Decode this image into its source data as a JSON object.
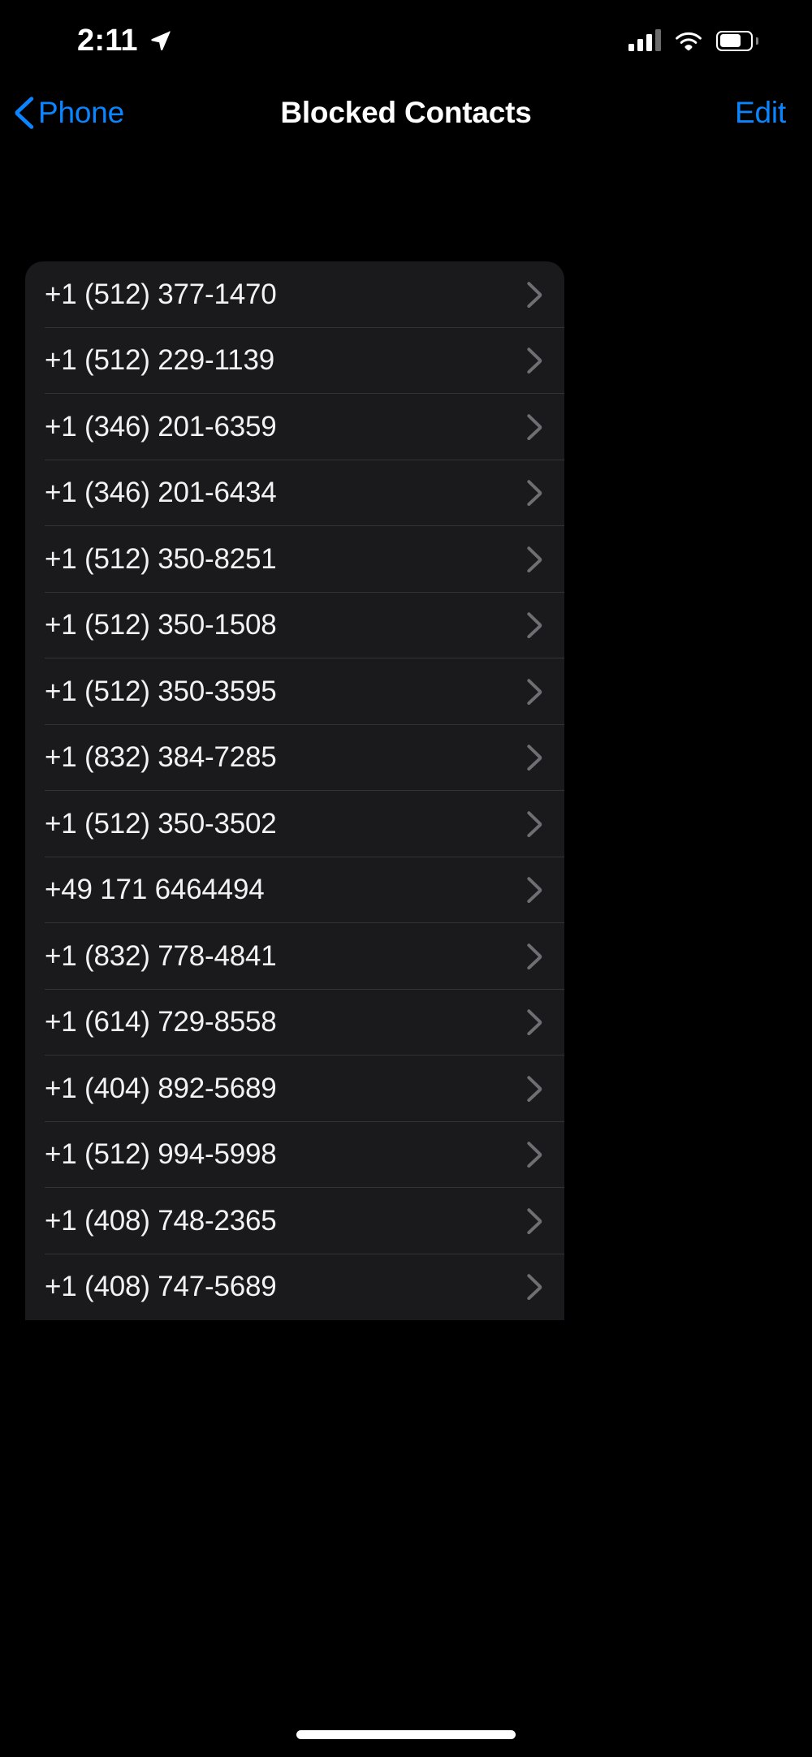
{
  "status_bar": {
    "time": "2:11",
    "location_icon": "location-arrow-icon",
    "cellular_icon": "cellular-signal-icon",
    "cellular_bars_filled": 3,
    "wifi_icon": "wifi-icon",
    "battery_icon": "battery-icon",
    "battery_level_percent": 72
  },
  "nav_bar": {
    "back_icon": "chevron-left-icon",
    "back_label": "Phone",
    "title": "Blocked Contacts",
    "edit_label": "Edit",
    "accent_color": "#0a84ff"
  },
  "list": {
    "disclosure_icon": "chevron-right-icon",
    "items": [
      {
        "number": "+1 (512) 377-1470"
      },
      {
        "number": "+1 (512) 229-1139"
      },
      {
        "number": "+1 (346) 201-6359"
      },
      {
        "number": "+1 (346) 201-6434"
      },
      {
        "number": "+1 (512) 350-8251"
      },
      {
        "number": "+1 (512) 350-1508"
      },
      {
        "number": "+1 (512) 350-3595"
      },
      {
        "number": "+1 (832) 384-7285"
      },
      {
        "number": "+1 (512) 350-3502"
      },
      {
        "number": "+49 171 6464494"
      },
      {
        "number": "+1 (832) 778-4841"
      },
      {
        "number": "+1 (614) 729-8558"
      },
      {
        "number": "+1 (404) 892-5689"
      },
      {
        "number": "+1 (512) 994-5998"
      },
      {
        "number": "+1 (408) 748-2365"
      },
      {
        "number": "+1 (408) 747-5689"
      }
    ]
  },
  "home_indicator": {
    "name": "home-indicator"
  },
  "theme": {
    "background": "#000000",
    "card_background": "#1a1a1c",
    "separator": "#333336",
    "primary_text": "#f2f2f2",
    "accent": "#0a84ff",
    "chevron": "#6e6e73"
  }
}
